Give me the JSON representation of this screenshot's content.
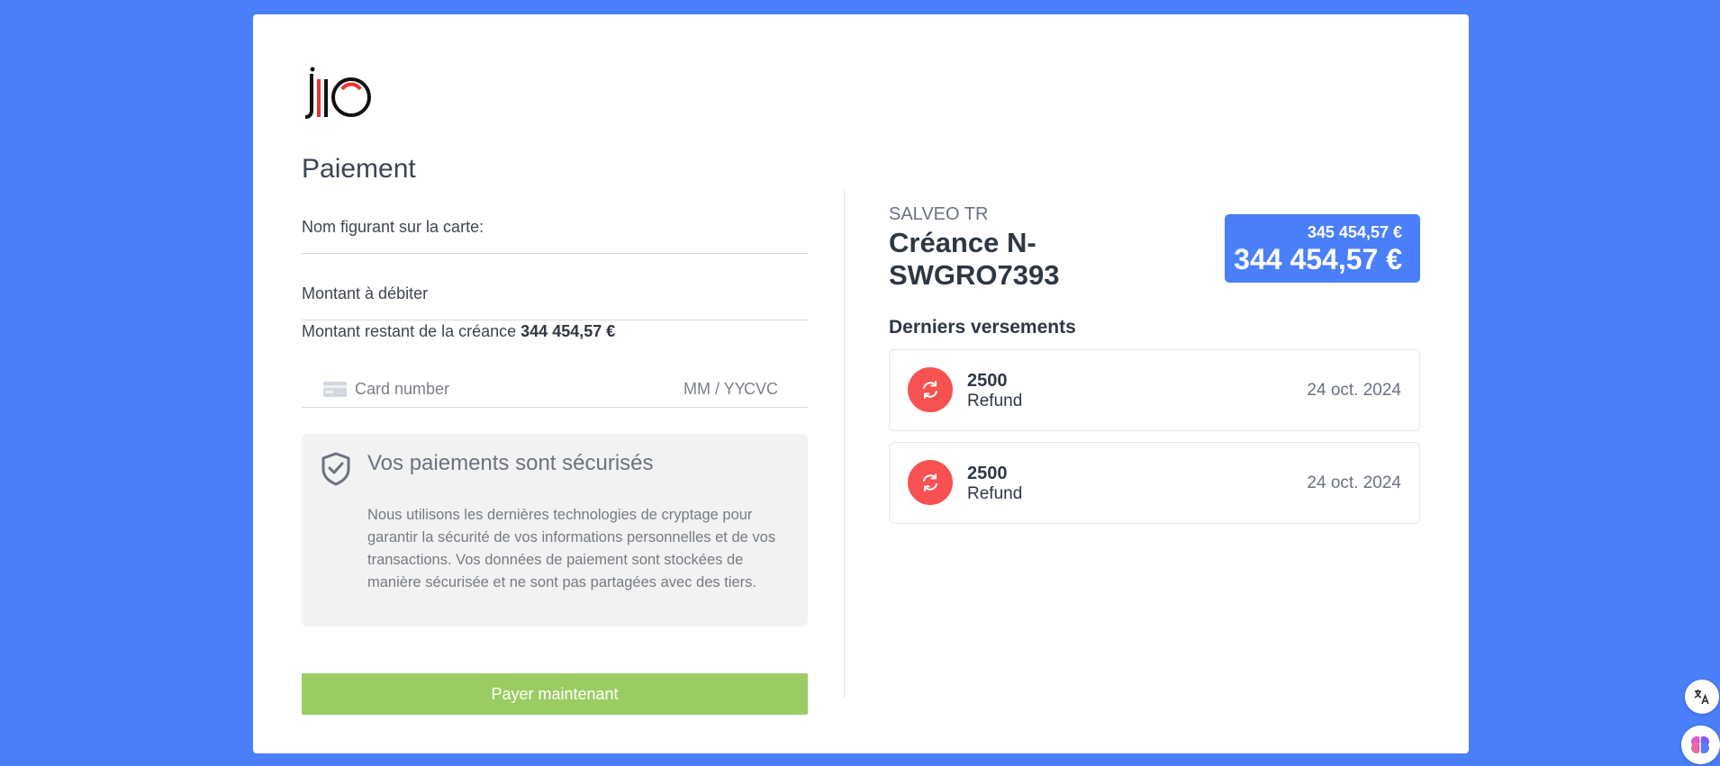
{
  "brand": {
    "logo_name": "jio-logo"
  },
  "page": {
    "title": "Paiement"
  },
  "form": {
    "name_label": "Nom figurant sur la carte:",
    "amount_label": "Montant à débiter",
    "remaining_label": "Montant restant de la créance",
    "remaining_value": "344 454,57 €",
    "card_placeholder": "Card number",
    "expiry_placeholder": "MM / YY",
    "cvc_placeholder": "CVC"
  },
  "security": {
    "title": "Vos paiements sont sécurisés",
    "text": "Nous utilisons les dernières technologies de cryptage pour garantir la sécurité de vos informations personnelles et de vos transactions. Vos données de paiement sont stockées de manière sécurisée et ne sont pas partagées avec des tiers."
  },
  "pay_button_label": "Payer maintenant",
  "summary": {
    "creditor": "SALVEO TR",
    "debt_title": "Créance N-SWGRO7393",
    "original_amount": "345 454,57 €",
    "current_amount": "344 454,57 €"
  },
  "payments": {
    "heading": "Derniers versements",
    "items": [
      {
        "amount": "2500",
        "type": "Refund",
        "date": "24 oct. 2024",
        "icon": "refund-icon"
      },
      {
        "amount": "2500",
        "type": "Refund",
        "date": "24 oct. 2024",
        "icon": "refund-icon"
      }
    ]
  },
  "colors": {
    "background": "#4a7ffa",
    "accent": "#4a7ffa",
    "pay_button": "#9bcc63",
    "refund": "#f75151"
  }
}
